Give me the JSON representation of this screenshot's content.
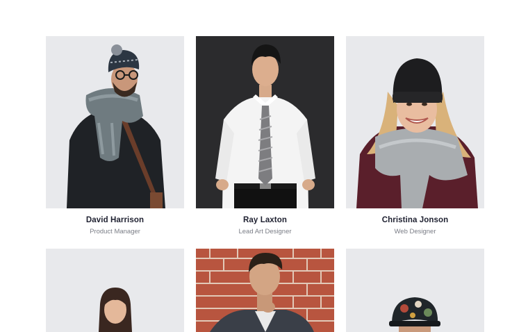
{
  "team": [
    {
      "name": "David Harrison",
      "role": "Product Manager"
    },
    {
      "name": "Ray Laxton",
      "role": "Lead Art Designer"
    },
    {
      "name": "Christina Jonson",
      "role": "Web Designer"
    },
    {
      "name": "",
      "role": ""
    },
    {
      "name": "",
      "role": ""
    },
    {
      "name": "",
      "role": ""
    }
  ],
  "colors": {
    "photo_bg_light": "#e8e9ec",
    "photo_bg_dark": "#2b2b2d",
    "name_text": "#1e2030",
    "role_text": "#7a7d86",
    "brick": "#b8553f"
  },
  "icons": [
    "person-photo"
  ]
}
